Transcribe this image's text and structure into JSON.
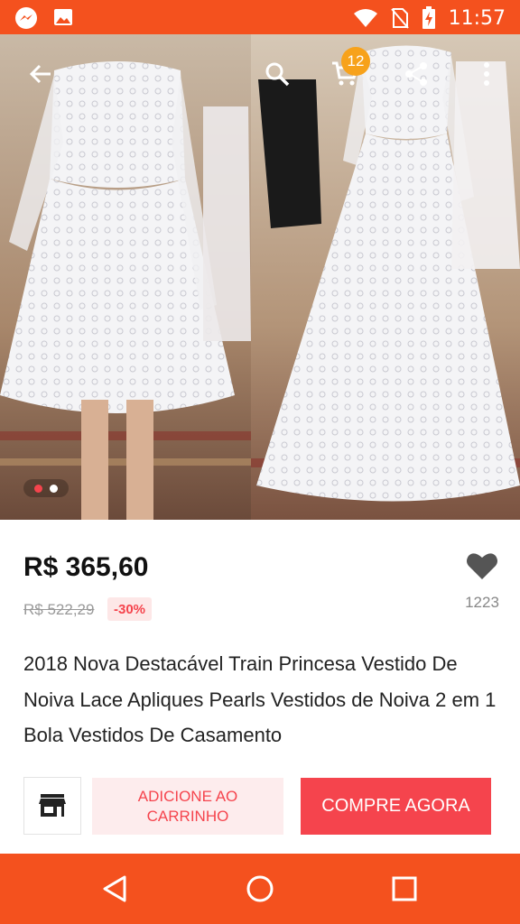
{
  "status_bar": {
    "time": "11:57",
    "left_icons": [
      "messenger-icon",
      "gallery-icon"
    ],
    "right_icons": [
      "wifi-icon",
      "no-sim-icon",
      "battery-charging-icon"
    ]
  },
  "colors": {
    "accent": "#f4511e",
    "price_red": "#f5444d",
    "badge_orange": "#f7a21b"
  },
  "gallery": {
    "current_image": 1,
    "image_count": 2
  },
  "toolbar": {
    "back_icon": "back-arrow-icon",
    "search_icon": "search-icon",
    "cart_icon": "cart-icon",
    "cart_count": "12",
    "share_icon": "share-icon",
    "more_icon": "more-vert-icon"
  },
  "product": {
    "price": "R$ 365,60",
    "original_price": "R$ 522,29",
    "discount": "-30%",
    "wishlist_count": "1223",
    "title": "2018 Nova Destacável Train Princesa Vestido De Noiva Lace Apliques Pearls Vestidos de Noiva 2 em 1 Bola Vestidos De Casamento"
  },
  "actions": {
    "store_icon": "store-icon",
    "add_to_cart": "ADICIONE AO CARRINHO",
    "buy_now": "COMPRE AGORA"
  },
  "nav_bar": {
    "back_icon": "nav-back-icon",
    "home_icon": "nav-home-icon",
    "recents_icon": "nav-recents-icon"
  }
}
